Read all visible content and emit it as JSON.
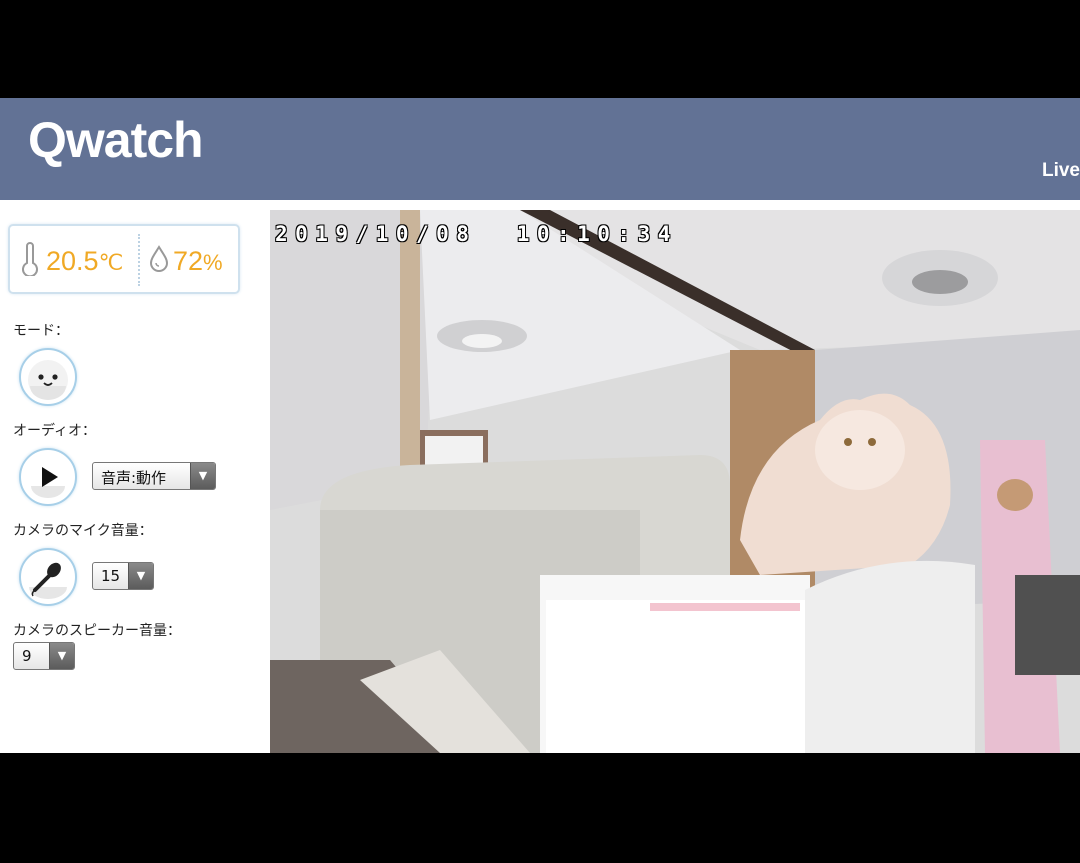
{
  "app": {
    "logo": "Qwatch",
    "live_label": "Live"
  },
  "environment": {
    "temperature": "20.5",
    "temperature_unit": "℃",
    "humidity": "72",
    "humidity_unit": "%"
  },
  "controls": {
    "mode": {
      "label": "モード："
    },
    "audio": {
      "label": "オーディオ：",
      "select_value": "音声:動作"
    },
    "mic_volume": {
      "label": "カメラのマイク音量：",
      "select_value": "15"
    },
    "speaker_volume": {
      "label": "カメラのスピーカー音量：",
      "select_value": "9"
    }
  },
  "video": {
    "timestamp": "2019/10/08  10:10:34"
  },
  "colors": {
    "header": "#627295",
    "accent_value": "#f0a925",
    "circle_border": "#a7cfe8"
  },
  "icons": [
    "thermometer-icon",
    "humidity-drop-icon",
    "smiley-mode-icon",
    "play-icon",
    "microphone-icon",
    "dropdown-arrow-icon"
  ]
}
